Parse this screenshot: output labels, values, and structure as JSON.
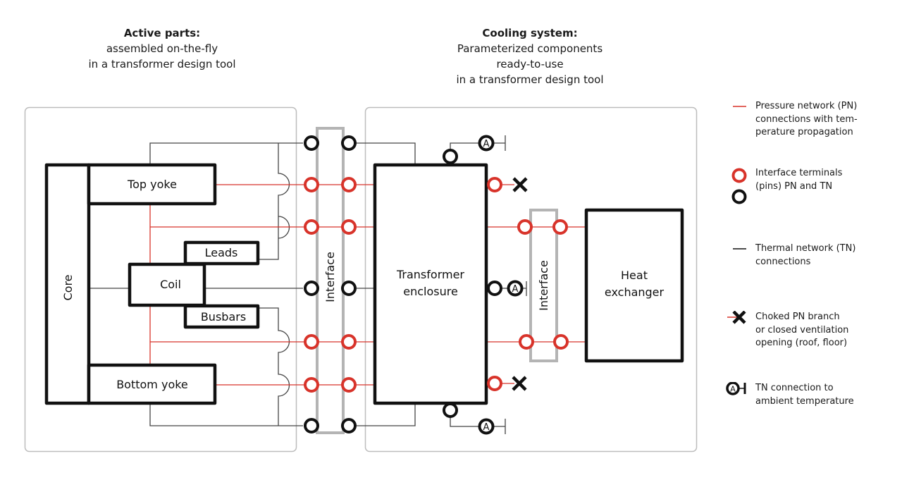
{
  "colors": {
    "pressure_network": "#d8332a",
    "thermal_network": "#1a1a1a",
    "interface_frame": "#b4b4b4",
    "group_border": "#bdbdbd"
  },
  "headings": {
    "active_parts": {
      "title": "Active parts:",
      "lines": [
        "assembled on-the-fly",
        "in a transformer design tool"
      ]
    },
    "cooling_system": {
      "title": "Cooling system:",
      "lines": [
        "Parameterized components",
        "ready-to-use",
        "in a transformer design tool"
      ]
    }
  },
  "components": {
    "core": "Core",
    "top_yoke": "Top yoke",
    "leads": "Leads",
    "coil": "Coil",
    "busbars": "Busbars",
    "bottom_yoke": "Bottom yoke",
    "interface_left": "Interface",
    "transformer_enclosure": [
      "Transformer",
      "enclosure"
    ],
    "interface_right": "Interface",
    "heat_exchanger": [
      "Heat",
      "exchanger"
    ],
    "ambient_symbol": "A"
  },
  "legend": [
    {
      "icon": "pressure-line-icon",
      "lines": [
        "Pressure network (PN)",
        "connections with tem-",
        "perature propagation"
      ]
    },
    {
      "icon": "interface-terminal-icon",
      "lines": [
        "Interface terminals",
        "(pins) PN and TN"
      ]
    },
    {
      "icon": "thermal-line-icon",
      "lines": [
        "Thermal network (TN)",
        "connections"
      ]
    },
    {
      "icon": "choked-branch-icon",
      "lines": [
        "Choked PN branch",
        "or closed ventilation",
        "opening (roof, floor)"
      ]
    },
    {
      "icon": "ambient-connection-icon",
      "lines": [
        "TN connection to",
        "ambient temperature"
      ]
    }
  ]
}
